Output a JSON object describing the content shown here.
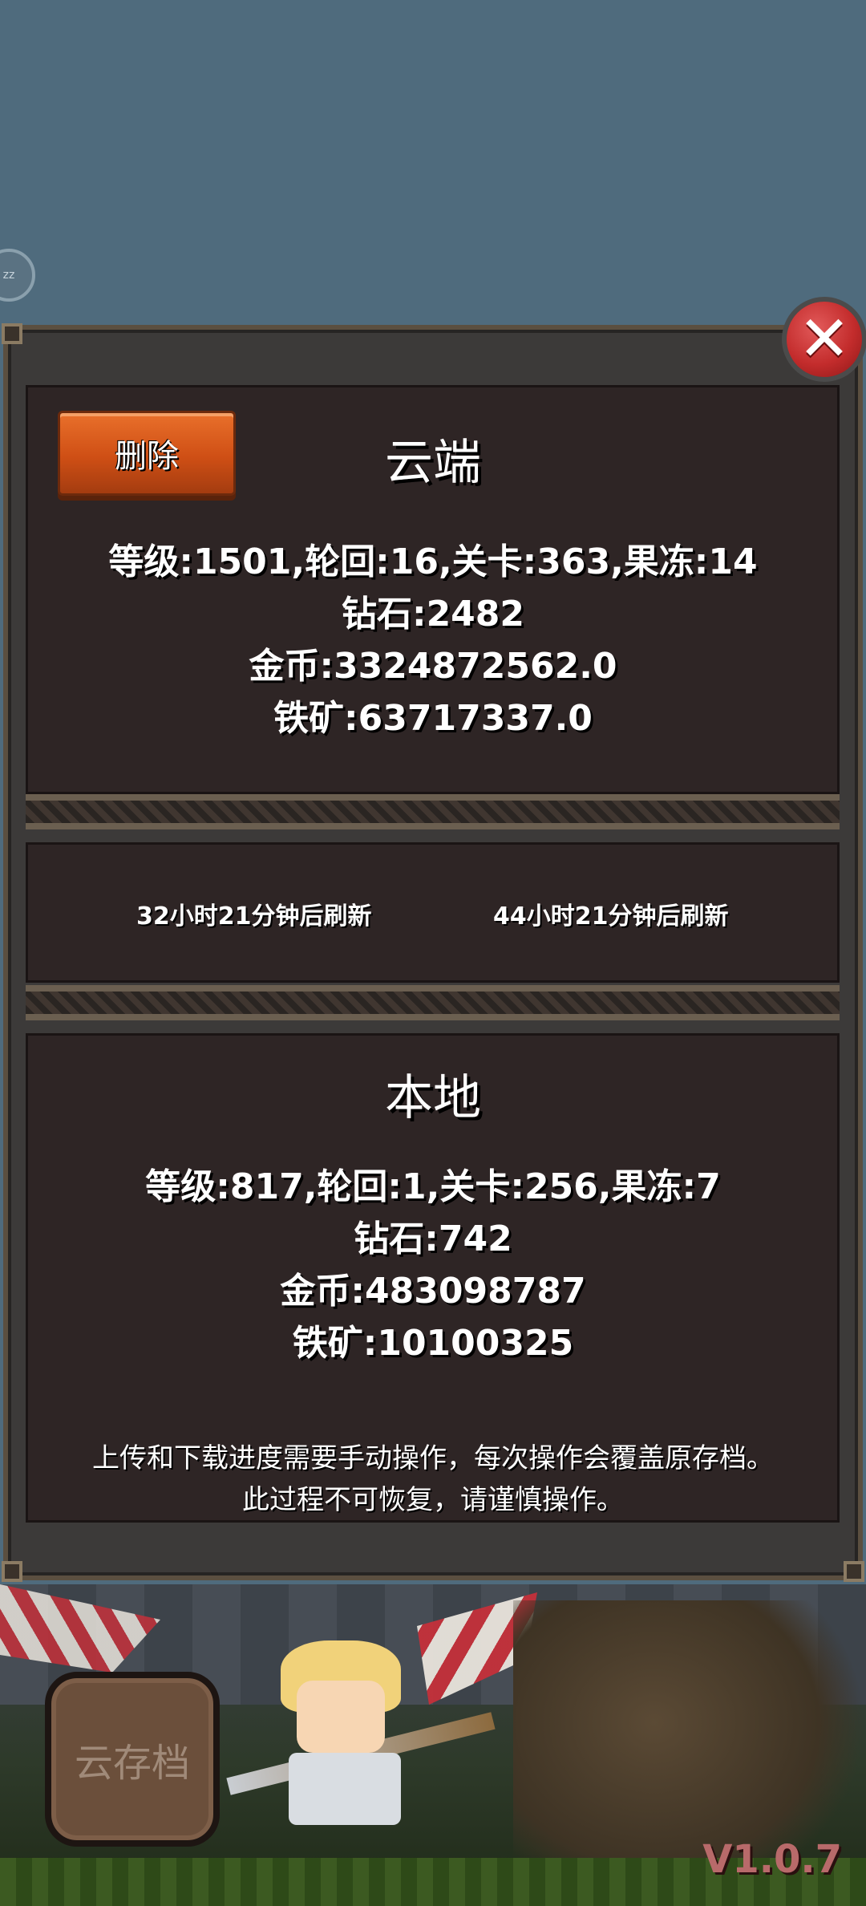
{
  "badge": {
    "label": "zz"
  },
  "dialog": {
    "close_label": "✕",
    "delete_label": "删除",
    "cloud": {
      "title": "云端",
      "line1": "等级:1501,轮回:16,关卡:363,果冻:14",
      "line2": "钻石:2482",
      "line3": "金币:3324872562.0",
      "line4": "铁矿:63717337.0"
    },
    "refresh": {
      "left": "32小时21分钟后刷新",
      "right": "44小时21分钟后刷新"
    },
    "local": {
      "title": "本地",
      "line1": "等级:817,轮回:1,关卡:256,果冻:7",
      "line2": "钻石:742",
      "line3": "金币:483098787",
      "line4": "铁矿:10100325"
    },
    "notice": {
      "line1": "上传和下载进度需要手动操作，每次操作会覆盖原存档。",
      "line2": "此过程不可恢复，请谨慎操作。"
    }
  },
  "bottom": {
    "cloud_save_label": "云存档",
    "version": "V1.0.7"
  },
  "colors": {
    "sky": "#4f6b7d",
    "panel": "#2e2525",
    "delete_button": "#cf4f15",
    "close_button": "#c32c2c",
    "version_text": "#b86a6a"
  }
}
